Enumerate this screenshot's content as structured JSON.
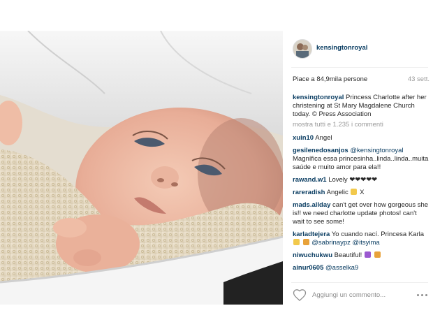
{
  "post": {
    "image_alt": "Baby in white lace christening gown lying in a pram",
    "username": "kensingtonroyal",
    "likes": "Piace a 84,9mila persone",
    "time": "43 sett.",
    "caption": {
      "username": "kensingtonroyal",
      "text": "Princess Charlotte after her christening at St Mary Magdalene Church today. © Press Association"
    },
    "show_all_comments": "mostra tutti e 1.235 i commenti",
    "comments": [
      {
        "user": "xuin10",
        "mention": "",
        "text": "Angel"
      },
      {
        "user": "gesilenedosanjos",
        "mention": "@kensingtonroyal",
        "text": "Magnífica essa princesinha..linda..linda..muita saúde e muito amor para ela!!"
      },
      {
        "user": "rawand.w1",
        "mention": "",
        "text": "Lovely ❤❤❤❤❤"
      },
      {
        "user": "rareradish",
        "mention": "",
        "text": "Angelic",
        "text_after": "X"
      },
      {
        "user": "mads.allday",
        "mention": "",
        "text": "can't get over how gorgeous she is!! we need charlotte update photos! can't wait to see some!"
      },
      {
        "user": "karladtejera",
        "mention": "",
        "text": "Yo cuando nací. Princesa Karla",
        "mention2": "@sabrinaypz",
        "mention3": "@itsyima"
      },
      {
        "user": "niwuchukwu",
        "mention": "",
        "text": "Beautiful!"
      },
      {
        "user": "ainur0605",
        "mention": "@asselka9",
        "text": ""
      }
    ],
    "add_comment_placeholder": "Aggiungi un commento..."
  },
  "icons": {
    "like": "heart-outline-icon",
    "options": "more-options-icon"
  },
  "colors": {
    "username": "#0a3d62",
    "muted": "#9a9a9a",
    "heart_emoji": "#262626",
    "halo_emoji": "#f2c94c",
    "purple_heart": "#9b59d0"
  }
}
